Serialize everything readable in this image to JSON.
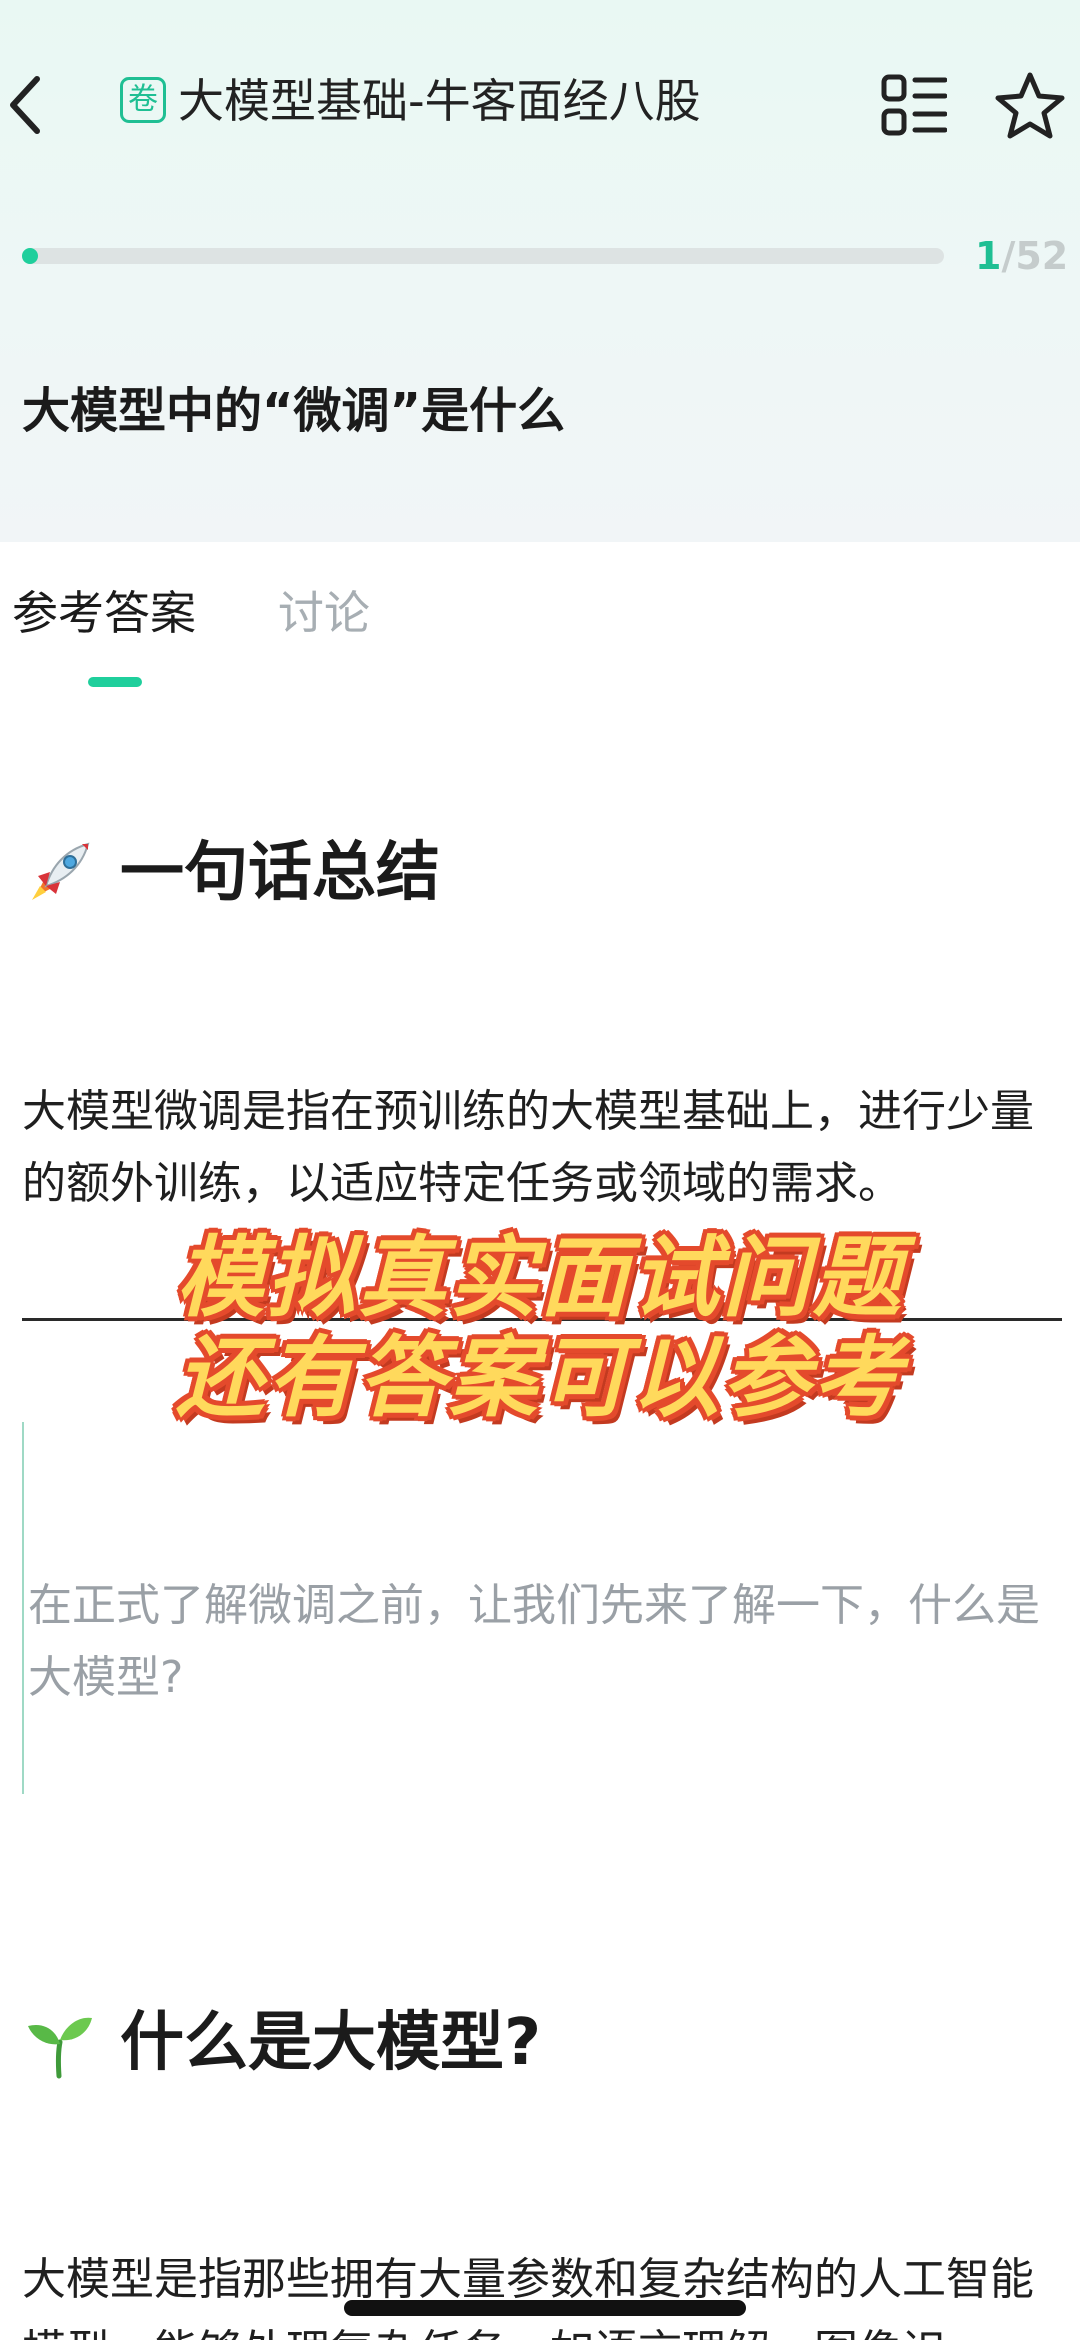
{
  "header": {
    "back_icon": "chevron-left-icon",
    "paper_badge": "卷",
    "title": "大模型基础-牛客面经八股",
    "list_icon": "question-list-icon",
    "favorite_icon": "star-outline-icon"
  },
  "progress": {
    "current": "1",
    "separator": "/",
    "total": "52",
    "fraction": 0.019
  },
  "question": {
    "title": "大模型中的“微调”是什么"
  },
  "tabs": [
    {
      "label": "参考答案",
      "active": true
    },
    {
      "label": "讨论",
      "active": false
    }
  ],
  "content": {
    "section1": {
      "emoji": "rocket-icon",
      "title": "一句话总结"
    },
    "summary": "大模型微调是指在预训练的大模型基础上，进行少量的额外训练，以适应特定任务或领域的需求。",
    "quote": "在正式了解微调之前，让我们先来了解一下，什么是大模型?",
    "section2": {
      "emoji": "seedling-icon",
      "title": "什么是大模型?"
    },
    "intro": "大模型是指那些拥有大量参数和复杂结构的人工智能模型，能够处理复杂任务，如语言理解、图像识"
  },
  "overlay": {
    "line1": "模拟真实面试问题",
    "line2": "还有答案可以参考"
  },
  "colors": {
    "accent": "#1fcf9c",
    "overlay_fill": "#ffd95c",
    "overlay_stroke": "#e44a2c"
  }
}
